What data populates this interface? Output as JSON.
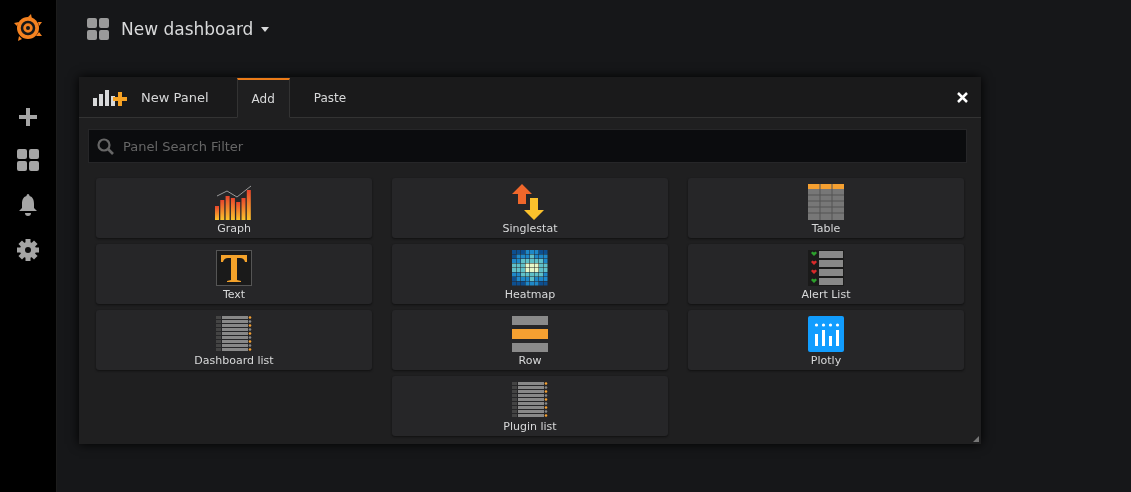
{
  "topbar": {
    "title": "New dashboard"
  },
  "sidebar": {
    "items": [
      {
        "kind": "plus"
      },
      {
        "kind": "dashboards"
      },
      {
        "kind": "alerts"
      },
      {
        "kind": "settings"
      }
    ]
  },
  "panel": {
    "title": "New Panel",
    "tabs": [
      {
        "label": "Add",
        "selected": true
      },
      {
        "label": "Paste",
        "selected": false
      }
    ],
    "search": {
      "placeholder": "Panel Search Filter"
    },
    "columns": [
      {
        "tiles": [
          {
            "label": "Graph",
            "kind": "graph"
          },
          {
            "label": "Text",
            "kind": "text"
          },
          {
            "label": "Dashboard list",
            "kind": "list"
          }
        ]
      },
      {
        "tiles": [
          {
            "label": "Singlestat",
            "kind": "singlestat"
          },
          {
            "label": "Heatmap",
            "kind": "heatmap"
          },
          {
            "label": "Row",
            "kind": "row"
          },
          {
            "label": "Plugin list",
            "kind": "list"
          }
        ]
      },
      {
        "tiles": [
          {
            "label": "Table",
            "kind": "table"
          },
          {
            "label": "Alert List",
            "kind": "alertlist"
          },
          {
            "label": "Plotly",
            "kind": "plotly"
          }
        ]
      }
    ]
  }
}
